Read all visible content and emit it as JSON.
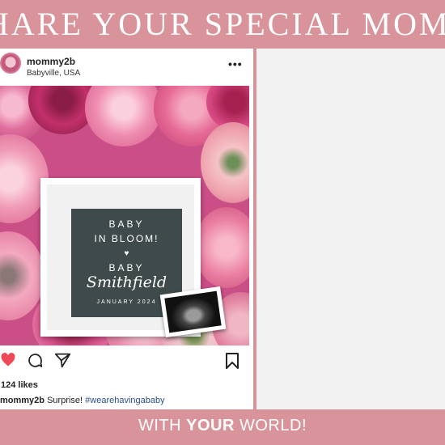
{
  "banner": {
    "headline": "HARE YOUR SPECIAL MOMENT",
    "tagline_pre": "WITH ",
    "tagline_bold": "YOUR",
    "tagline_post": " WORLD!"
  },
  "post": {
    "username": "mommy2b",
    "location": "Babyville, USA",
    "more": "•••",
    "likes": "124 likes",
    "caption_user": "mommy2b",
    "caption_text": " Surprise! ",
    "hashtag": "#wearehavingababy"
  },
  "letterboard": {
    "line1": "BABY",
    "line2": "IN BLOOM!",
    "heart": "♥",
    "line3": "BABY",
    "line4": "Smithfield",
    "line5": "JANUARY 2024"
  },
  "icons": {
    "heart": "heart-icon",
    "comment": "comment-icon",
    "share": "share-icon",
    "bookmark": "bookmark-icon",
    "more": "more-icon"
  },
  "colors": {
    "banner": "#d9939a",
    "heart": "#ed4956",
    "hashtag": "#2d4f8a",
    "board": "#3f4b4a"
  }
}
